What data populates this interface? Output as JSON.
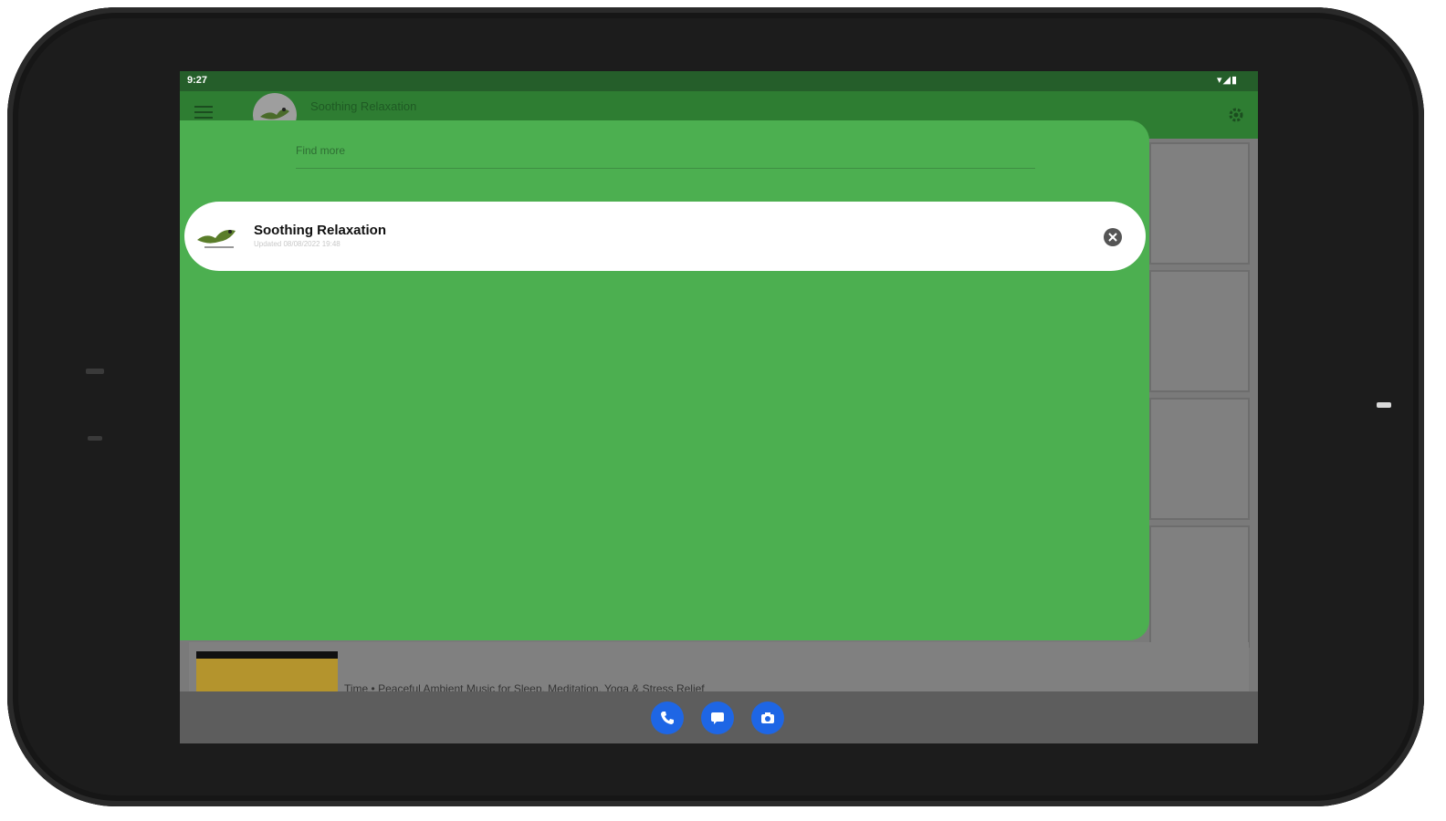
{
  "status_bar": {
    "time": "9:27",
    "icons": [
      "wifi-icon",
      "signal-icon",
      "battery-icon"
    ]
  },
  "app_bar": {
    "title": "Soothing Relaxation"
  },
  "search_sheet": {
    "placeholder": "Find more",
    "result": {
      "title": "Soothing Relaxation",
      "subtitle": "Updated 08/08/2022 19:48"
    }
  },
  "video": {
    "title": "Time • Peaceful Ambient Music for Sleep, Meditation, Yoga & Stress Relief"
  },
  "nav_bar": {
    "buttons": [
      "phone-icon",
      "message-icon",
      "camera-icon"
    ]
  },
  "colors": {
    "status_bar": "#255e2a",
    "app_bar": "#2e7d32",
    "sheet": "#4caf50",
    "nav_button": "#1e66e5"
  }
}
